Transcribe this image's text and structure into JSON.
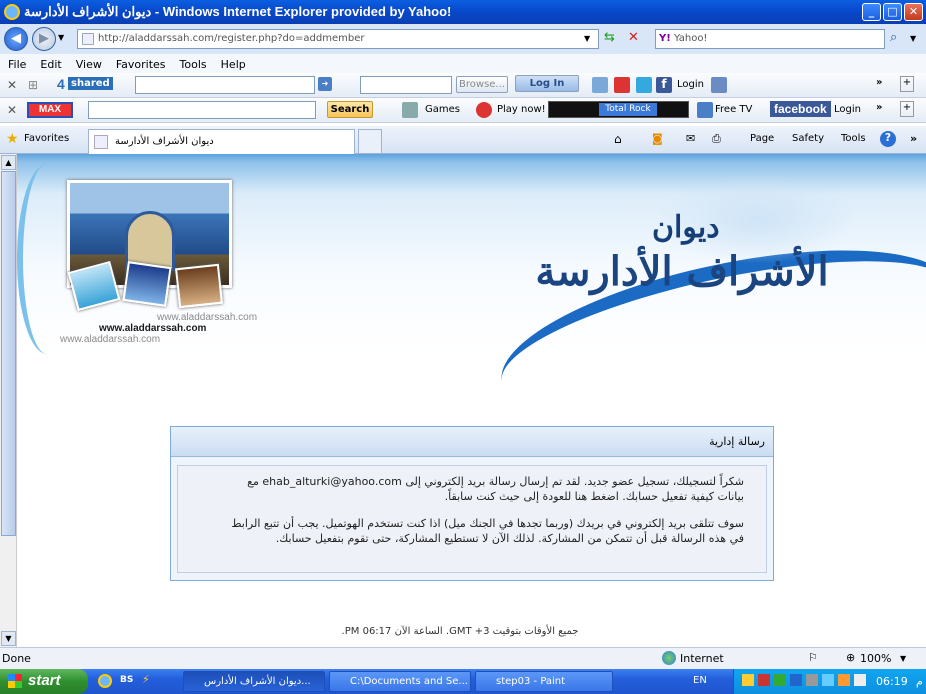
{
  "window": {
    "title": "ديوان الأشراف الأدارسة - Windows Internet Explorer provided by Yahoo!"
  },
  "address": {
    "host": "aladdarssah.com",
    "url": "http://aladdarssah.com/register.php?do=addmember"
  },
  "search": {
    "placeholder": "Yahoo!"
  },
  "menu": [
    "File",
    "Edit",
    "View",
    "Favorites",
    "Tools",
    "Help"
  ],
  "toolbar1": {
    "shared": "shared",
    "browse": "Browse...",
    "login_btn": "Log In",
    "login": "Login"
  },
  "toolbar2": {
    "search": "Search",
    "games": "Games",
    "playnow": "Play now!",
    "totalrock": "Total Rock",
    "freetv": "Free TV",
    "facebook": "facebook",
    "login": "Login"
  },
  "favorites": {
    "label": "Favorites",
    "tab": "ديوان الأشراف الأدارسة"
  },
  "cmdbar": {
    "page": "Page",
    "safety": "Safety",
    "tools": "Tools"
  },
  "header": {
    "url1": "www.aladdarssah.com",
    "url2": "www.aladdarssah.com",
    "url3": "www.aladdarssah.com",
    "logo_small": "ديوان",
    "logo_big": "الأشراف الأدارسة"
  },
  "message": {
    "title": "رسالة إدارية",
    "para1a": "شكراً لتسجيلك، تسجيل عضو جديد. لقد تم إرسال رسالة بريد إلكتروني إلى ehab_alturki@yahoo.com مع",
    "para1b": "بيانات كيفية تفعيل حسابك. اضغط هنا للعودة إلى حيث كنت سابقاً.",
    "para2a": "سوف تتلقى بريد إلكتروني في بريدك (وربما تجدها في الجنك ميل) اذا كنت تستخدم الهوتميل. يجب أن تتبع الرابط",
    "para2b": "في هذه الرسالة قبل أن تتمكن من المشاركة. لذلك الآن لا تستطيع المشاركة، حتى تقوم بتفعيل حسابك."
  },
  "footer": "جميع الأوقات بتوقيت GMT +3. الساعة الآن 06:17 PM.",
  "status": {
    "left": "Done",
    "zone": "Internet",
    "zoom": "100%"
  },
  "taskbar": {
    "start": "start",
    "ie": "ديوان الأشراف الأدارس...",
    "docs": "C:\\Documents and Se...",
    "paint": "step03 - Paint",
    "lang": "EN",
    "clock": "06:19",
    "ampm": "م"
  }
}
